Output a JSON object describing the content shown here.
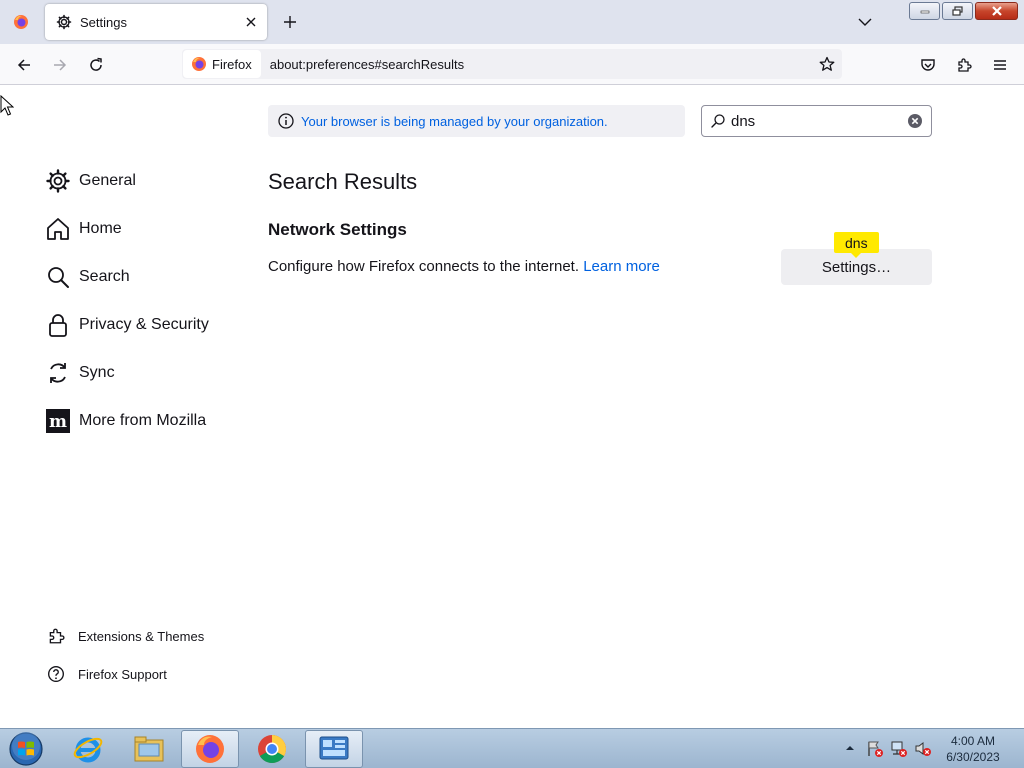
{
  "browser": {
    "tab": {
      "title": "Settings"
    },
    "urlbar": {
      "identity_label": "Firefox",
      "url": "about:preferences#searchResults"
    }
  },
  "policies": {
    "text": "Your browser is being managed by your organization."
  },
  "search": {
    "value": "dns"
  },
  "sidebar": {
    "categories": [
      {
        "label": "General",
        "icon": "gear-icon"
      },
      {
        "label": "Home",
        "icon": "home-icon"
      },
      {
        "label": "Search",
        "icon": "search-icon"
      },
      {
        "label": "Privacy & Security",
        "icon": "lock-icon"
      },
      {
        "label": "Sync",
        "icon": "sync-icon"
      },
      {
        "label": "More from Mozilla",
        "icon": "mozilla-icon"
      }
    ],
    "footer": [
      {
        "label": "Extensions & Themes",
        "icon": "puzzle-icon"
      },
      {
        "label": "Firefox Support",
        "icon": "help-icon"
      }
    ]
  },
  "main": {
    "results_title": "Search Results",
    "section_title": "Network Settings",
    "section_desc": "Configure how Firefox connects to the internet.",
    "learn_more": "Learn more",
    "settings_button": "Settings…",
    "tooltip": "dns"
  },
  "taskbar": {
    "apps": [
      "internet-explorer-icon",
      "file-explorer-icon",
      "firefox-icon",
      "chrome-icon",
      "control-panel-icon"
    ],
    "time": "4:00 AM",
    "date": "6/30/2023"
  },
  "colors": {
    "link": "#0061e0",
    "tooltip": "#ffe900",
    "tab_strip": "#dfe3ee"
  }
}
